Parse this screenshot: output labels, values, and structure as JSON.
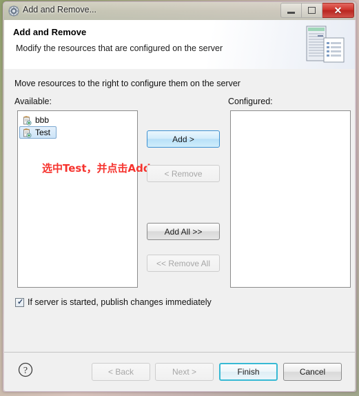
{
  "window": {
    "title": "Add and Remove...",
    "title_icon": "gear-icon",
    "minimize_label": "Minimize",
    "maximize_label": "Maximize",
    "close_label": "Close",
    "close_glyph": "✕"
  },
  "header": {
    "title": "Add and Remove",
    "subtitle": "Modify the resources that are configured on the server",
    "banner_icon": "server-and-document-icon"
  },
  "body": {
    "instruction": "Move resources to the right to configure them on the server",
    "available_label": "Available:",
    "configured_label": "Configured:",
    "available_items": [
      {
        "label": "bbb",
        "icon": "project-module-icon",
        "selected": false
      },
      {
        "label": "Test",
        "icon": "project-module-icon",
        "selected": true
      }
    ],
    "configured_items": [],
    "annotation": "选中Test，并点击Add",
    "buttons": {
      "add": "Add >",
      "remove": "< Remove",
      "add_all": "Add All >>",
      "remove_all": "<< Remove All"
    },
    "checkbox": {
      "label": "If server is started, publish changes immediately",
      "checked": true,
      "tick_glyph": "✓"
    }
  },
  "footer": {
    "help_icon": "help-question-icon",
    "help_glyph": "?",
    "back": "< Back",
    "next": "Next >",
    "finish": "Finish",
    "cancel": "Cancel"
  },
  "colors": {
    "accent_blue": "#3c8fd0",
    "default_focus": "#37b9d4",
    "annotation_red": "#f6332e",
    "close_red": "#cf342c",
    "selection_blue": "#cde4f7",
    "dialog_gray": "#f0f0f0"
  }
}
